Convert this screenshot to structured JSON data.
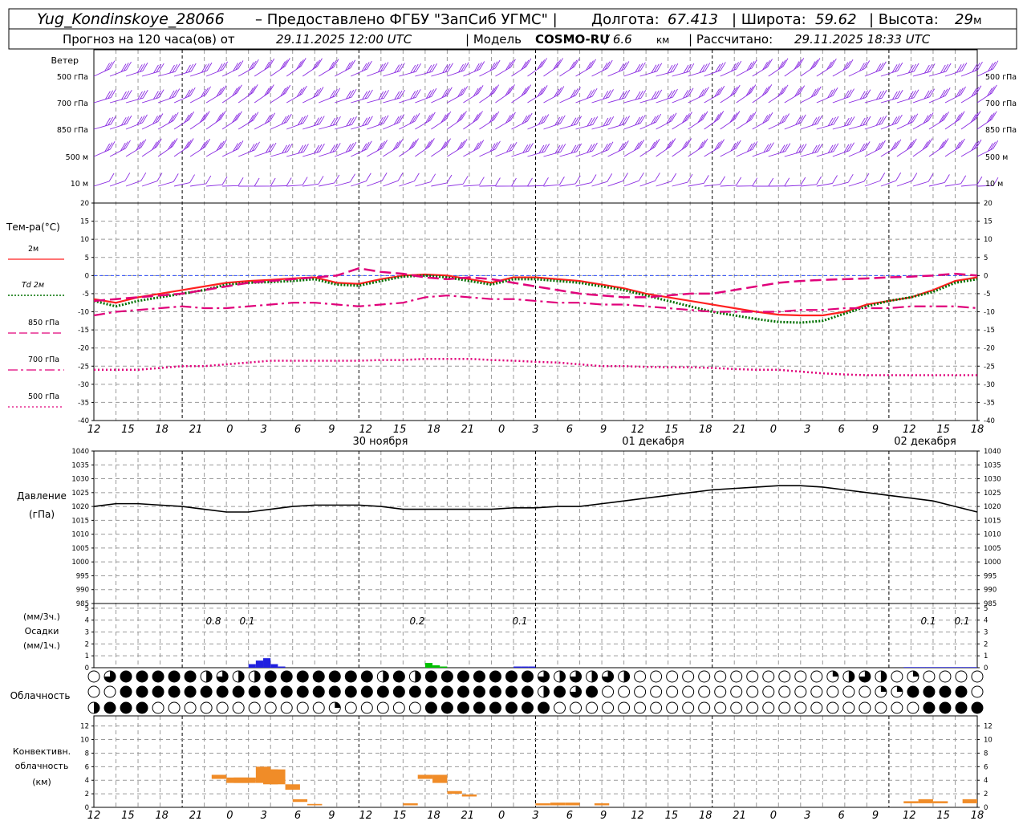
{
  "header": {
    "station": "Yug_Kondinskoye_28066",
    "provider": "– Предоставлено ФГБУ \"ЗапСиб УГМС\" |",
    "lon_label": "Долгота:",
    "lon_value": "67.413",
    "lat_label": "| Широта:",
    "lat_value": "59.62",
    "alt_label": "| Высота:",
    "alt_value": "29",
    "alt_unit": "м",
    "forecast_prefix": "Прогноз на 120 часа(ов) от",
    "forecast_time": "29.11.2025 12:00 UTC",
    "model_label": "| Модель",
    "model_name": "COSMO-RU",
    "model_res": "/ 6.6",
    "model_res_unit": "км",
    "computed_label": "| Рассчитано:",
    "computed_time": "29.11.2025 18:33 UTC"
  },
  "hour_ticks": [
    "12",
    "15",
    "18",
    "21",
    "0",
    "3",
    "6",
    "9",
    "12",
    "15",
    "18",
    "21",
    "0",
    "3",
    "6",
    "9",
    "12",
    "15",
    "18",
    "21",
    "0",
    "3",
    "6",
    "9",
    "12",
    "15",
    "18"
  ],
  "day_labels": [
    "30 ноября",
    "01 декабря",
    "02 декабря"
  ],
  "wind_panel": {
    "title": "Ветер",
    "levels": [
      "500 гПа",
      "700 гПа",
      "850 гПа",
      "500 м",
      "10  м"
    ],
    "levels_right": [
      "500 гПа",
      "700 гПа",
      "850 гПа",
      "500 м",
      "10  м"
    ],
    "color": "#8a2be2"
  },
  "temp_panel": {
    "title": "Тем-ра(°С)",
    "legend": [
      {
        "label": "2м",
        "color": "#ff2020",
        "style": "solid"
      },
      {
        "label": "Td  2м",
        "color": "#007000",
        "style": "dotted"
      },
      {
        "label": "850 гПа",
        "color": "#e0007a",
        "style": "dash"
      },
      {
        "label": "700 гПа",
        "color": "#e0007a",
        "style": "dashdot"
      },
      {
        "label": "500 гПа",
        "color": "#e0007a",
        "style": "dot"
      }
    ],
    "yticks": [
      "20",
      "15",
      "10",
      "5",
      "0",
      "-5",
      "-10",
      "-15",
      "-20",
      "-25",
      "-30",
      "-35",
      "-40"
    ]
  },
  "pressure_panel": {
    "title": "Давление",
    "unit": "(гПа)",
    "yticks": [
      "1040",
      "1035",
      "1030",
      "1025",
      "1020",
      "1015",
      "1010",
      "1005",
      "1000",
      "995",
      "990",
      "985"
    ]
  },
  "precip_panel": {
    "unit_top": "(мм/3ч.)",
    "title": "Осадки",
    "unit_bottom": "(мм/1ч.)",
    "yticks": [
      "5",
      "4",
      "3",
      "2",
      "1",
      "0"
    ],
    "totals": [
      "0.8",
      "0.1",
      "0.2",
      "0.1",
      "0.1",
      "0.1"
    ]
  },
  "cloud_panel": {
    "title": "Облачность"
  },
  "conv_panel": {
    "title1": "Конвективн.",
    "title2": "облачность",
    "unit": "(км)",
    "yticks": [
      "12",
      "10",
      "8",
      "6",
      "4",
      "2",
      "0"
    ]
  },
  "chart_data": [
    {
      "type": "line",
      "title": "Тем-ра(°С)",
      "x_hours": [
        0,
        3,
        6,
        9,
        12,
        15,
        18,
        21,
        24,
        27,
        30,
        33,
        36,
        39,
        42,
        45,
        48,
        51,
        54,
        57,
        60,
        63,
        66,
        69,
        72,
        75,
        78,
        81,
        84,
        87,
        90,
        93,
        96,
        99,
        102,
        105,
        108,
        111,
        114,
        117,
        120
      ],
      "ylim": [
        -40,
        20
      ],
      "series": [
        {
          "name": "2м",
          "values": [
            -6.5,
            -7.5,
            -6,
            -5,
            -4,
            -3,
            -2,
            -1.5,
            -1.2,
            -0.8,
            -0.5,
            -2,
            -2.3,
            -1,
            0,
            0.3,
            0,
            -1,
            -2,
            -0.5,
            -0.5,
            -1,
            -1.5,
            -2.5,
            -3.5,
            -5,
            -6,
            -7,
            -8,
            -9,
            -10,
            -10.8,
            -11,
            -11,
            -10,
            -8,
            -7,
            -6,
            -4,
            -1.5,
            -0.5
          ]
        },
        {
          "name": "Td  2м",
          "values": [
            -7,
            -8.5,
            -7,
            -6,
            -5,
            -4,
            -2.5,
            -2,
            -1.8,
            -1.5,
            -1,
            -2.5,
            -2.8,
            -1.5,
            -0.3,
            0,
            -0.5,
            -1.5,
            -2.5,
            -1,
            -1,
            -1.5,
            -2,
            -3,
            -4,
            -5.5,
            -7,
            -8.5,
            -10,
            -11,
            -12,
            -12.8,
            -13,
            -12.5,
            -10.5,
            -8.5,
            -7,
            -6,
            -4.5,
            -2,
            -1
          ]
        },
        {
          "name": "850 гПа",
          "values": [
            -7,
            -6.5,
            -6,
            -5.5,
            -5,
            -4,
            -3,
            -2,
            -1.5,
            -1,
            -0.5,
            0,
            2,
            1,
            0.5,
            -0.5,
            -1,
            -0.5,
            -1,
            -2,
            -3,
            -4,
            -5,
            -5.5,
            -6,
            -6,
            -5.5,
            -5,
            -5,
            -4,
            -3,
            -2,
            -1.5,
            -1.2,
            -1,
            -0.8,
            -0.5,
            -0.3,
            0,
            0.5,
            0
          ]
        },
        {
          "name": "700 гПа",
          "values": [
            -11,
            -10,
            -9.5,
            -9,
            -8.5,
            -9,
            -9,
            -8.5,
            -8,
            -7.5,
            -7.5,
            -8,
            -8.5,
            -8,
            -7.5,
            -6,
            -5.5,
            -6,
            -6.5,
            -6.5,
            -7,
            -7.5,
            -7.5,
            -8,
            -8,
            -8.5,
            -9,
            -9.5,
            -10,
            -10,
            -10,
            -10,
            -9.5,
            -9.5,
            -9,
            -9,
            -9,
            -8.5,
            -8.5,
            -8.5,
            -9
          ]
        },
        {
          "name": "500 гПа",
          "values": [
            -26,
            -26,
            -26,
            -25.5,
            -25,
            -25,
            -24.5,
            -24,
            -23.5,
            -23.5,
            -23.5,
            -23.5,
            -23.5,
            -23.3,
            -23.3,
            -23,
            -23,
            -23,
            -23.3,
            -23.5,
            -23.8,
            -24,
            -24.5,
            -25,
            -25,
            -25.2,
            -25.3,
            -25.3,
            -25.5,
            -25.8,
            -26,
            -26,
            -26.5,
            -27,
            -27.3,
            -27.5,
            -27.5,
            -27.5,
            -27.5,
            -27.5,
            -27.5
          ]
        }
      ]
    },
    {
      "type": "line",
      "title": "Давление",
      "ylabel": "(гПа)",
      "x_hours": [
        0,
        3,
        6,
        9,
        12,
        15,
        18,
        21,
        24,
        27,
        30,
        33,
        36,
        39,
        42,
        45,
        48,
        51,
        54,
        57,
        60,
        63,
        66,
        69,
        72,
        75,
        78,
        81,
        84,
        87,
        90,
        93,
        96,
        99,
        102,
        105,
        108,
        111,
        114,
        117,
        120
      ],
      "ylim": [
        985,
        1040
      ],
      "series": [
        {
          "name": "",
          "values": [
            1020,
            1021,
            1021,
            1020.5,
            1020,
            1019,
            1018,
            1018,
            1019,
            1020,
            1020.5,
            1020.5,
            1020.5,
            1020,
            1019,
            1019,
            1019,
            1019,
            1019,
            1019.5,
            1019.5,
            1020,
            1020,
            1021,
            1022,
            1023,
            1024,
            1025,
            1026,
            1026.5,
            1027,
            1027.5,
            1027.5,
            1027,
            1026,
            1025,
            1024,
            1023,
            1022,
            1020,
            1018
          ]
        }
      ]
    },
    {
      "type": "bar",
      "title": "Осадки",
      "ylabel": "(мм/1ч.)",
      "ylim": [
        0,
        5
      ],
      "series": [
        {
          "name": "",
          "color": "#2020e0",
          "bars": [
            [
              21,
              0.3
            ],
            [
              22,
              0.6
            ],
            [
              23,
              0.8
            ],
            [
              24,
              0.3
            ],
            [
              25,
              0.1
            ]
          ]
        },
        {
          "name": "",
          "color": "#00c000",
          "bars": [
            [
              45,
              0.4
            ],
            [
              46,
              0.2
            ],
            [
              47,
              0.1
            ]
          ]
        },
        {
          "name": "",
          "color": "#2020e0",
          "bars": [
            [
              57,
              0.1
            ],
            [
              58,
              0.1
            ],
            [
              59,
              0.1
            ]
          ]
        },
        {
          "name": "",
          "color": "#2020e0",
          "bars": [
            [
              110,
              0.05
            ],
            [
              111,
              0.05
            ],
            [
              112,
              0.05
            ],
            [
              113,
              0.05
            ],
            [
              114,
              0.05
            ],
            [
              115,
              0.05
            ],
            [
              116,
              0.05
            ],
            [
              117,
              0.05
            ],
            [
              118,
              0.05
            ],
            [
              119,
              0.05
            ]
          ]
        }
      ]
    },
    {
      "type": "bar",
      "title": "Конвективн. облачность",
      "ylabel": "(км)",
      "ylim": [
        0,
        13
      ],
      "color": "#f08c28",
      "bars": [
        [
          16,
          4.2,
          4.8
        ],
        [
          18,
          3.6,
          4.4
        ],
        [
          19,
          3.6,
          4.4
        ],
        [
          20,
          3.6,
          4.4
        ],
        [
          22,
          3.6,
          6.0
        ],
        [
          23,
          3.4,
          5.6
        ],
        [
          24,
          3.4,
          5.6
        ],
        [
          26,
          2.6,
          3.4
        ],
        [
          27,
          0.8,
          1.2
        ],
        [
          29,
          0.3,
          0.5
        ],
        [
          42,
          0.3,
          0.6
        ],
        [
          44,
          4.2,
          4.8
        ],
        [
          46,
          3.6,
          4.8
        ],
        [
          48,
          2.0,
          2.4
        ],
        [
          50,
          1.6,
          1.9
        ],
        [
          60,
          0.3,
          0.6
        ],
        [
          62,
          0.3,
          0.7
        ],
        [
          64,
          0.3,
          0.7
        ],
        [
          68,
          0.3,
          0.6
        ],
        [
          110,
          0.6,
          0.9
        ],
        [
          112,
          0.6,
          1.2
        ],
        [
          114,
          0.6,
          0.9
        ],
        [
          118,
          0.6,
          1.2
        ]
      ]
    }
  ]
}
